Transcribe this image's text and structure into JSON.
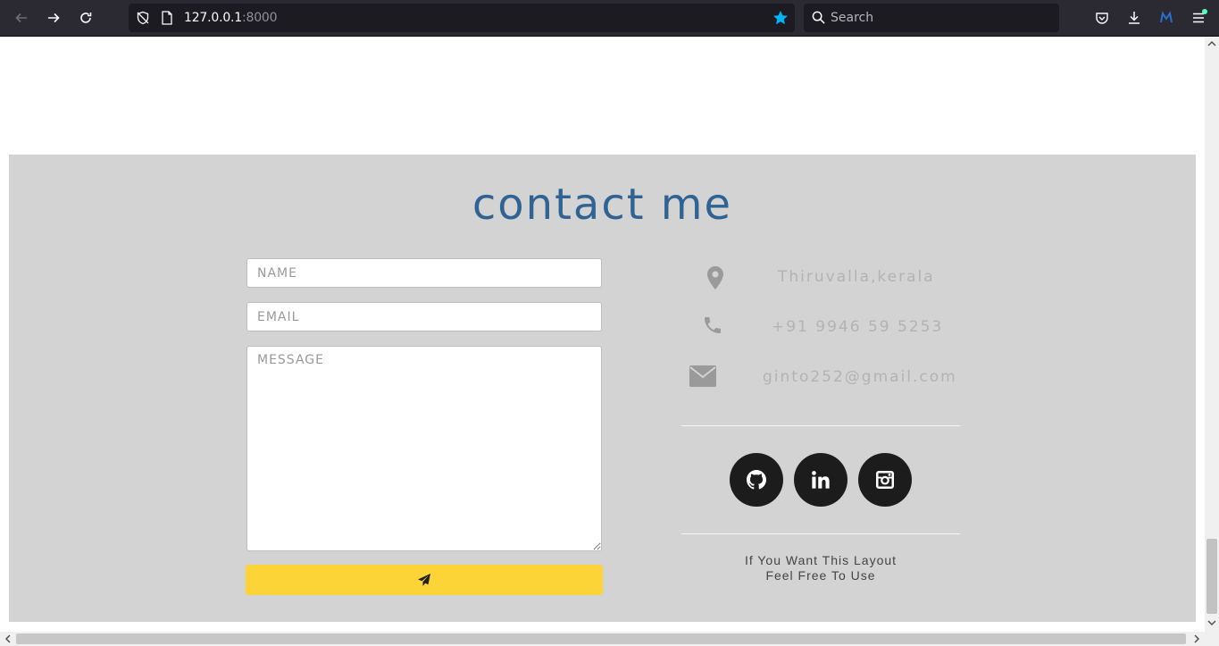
{
  "browser": {
    "url_host": "127.0.0.1",
    "url_port": ":8000",
    "search_placeholder": "Search"
  },
  "contact": {
    "title": "contact me",
    "form": {
      "name_placeholder": "NAME",
      "email_placeholder": "EMAIL",
      "message_placeholder": "MESSAGE"
    },
    "info": {
      "location": "Thiruvalla,kerala",
      "phone": "+91 9946 59 5253",
      "email": "ginto252@gmail.com"
    },
    "social": [
      "github-icon",
      "linkedin-icon",
      "instagram-icon"
    ],
    "footer_line1": "If You Want This Layout",
    "footer_line2": "Feel Free To Use"
  },
  "colors": {
    "section_bg": "#d3d3d3",
    "title": "#2f6394",
    "send_button": "#fdd438",
    "social_bg": "#1c1c1c",
    "star": "#00b3f4"
  }
}
